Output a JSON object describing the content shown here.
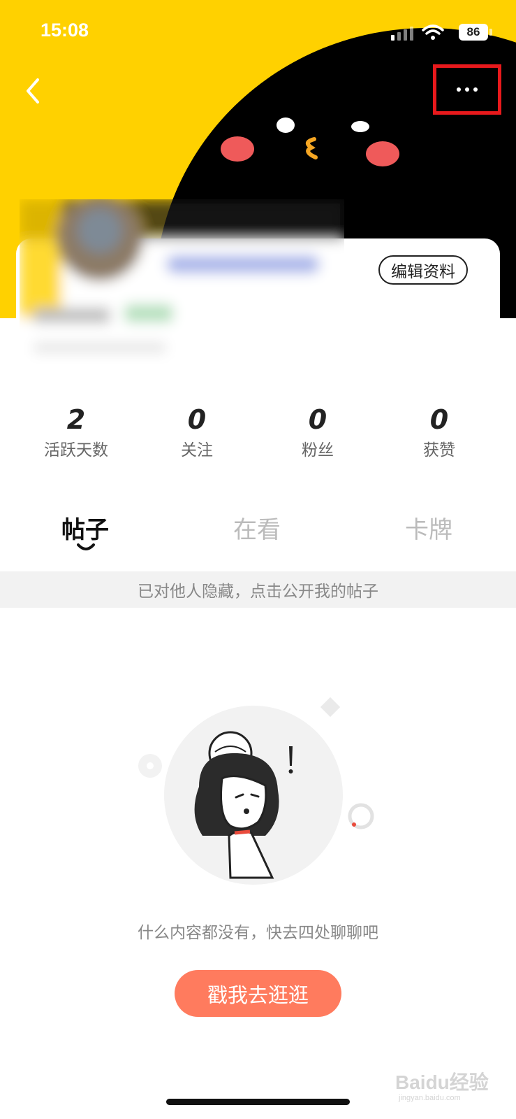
{
  "status_bar": {
    "time": "15:08",
    "battery": "86"
  },
  "profile": {
    "edit_label": "编辑资料"
  },
  "stats": [
    {
      "value": "2",
      "label": "活跃天数"
    },
    {
      "value": "0",
      "label": "关注"
    },
    {
      "value": "0",
      "label": "粉丝"
    },
    {
      "value": "0",
      "label": "获赞"
    }
  ],
  "tabs": [
    {
      "label": "帖子",
      "active": true
    },
    {
      "label": "在看",
      "active": false
    },
    {
      "label": "卡牌",
      "active": false
    }
  ],
  "notice": "已对他人隐藏，点击公开我的帖子",
  "empty_state": {
    "message": "什么内容都没有，快去四处聊聊吧",
    "button_label": "戳我去逛逛"
  },
  "watermark": {
    "brand": "Baidu经验",
    "url": "jingyan.baidu.com"
  },
  "colors": {
    "header_yellow": "#FFD100",
    "accent_button": "#FF7B5E",
    "highlight_box": "#E8191C"
  }
}
